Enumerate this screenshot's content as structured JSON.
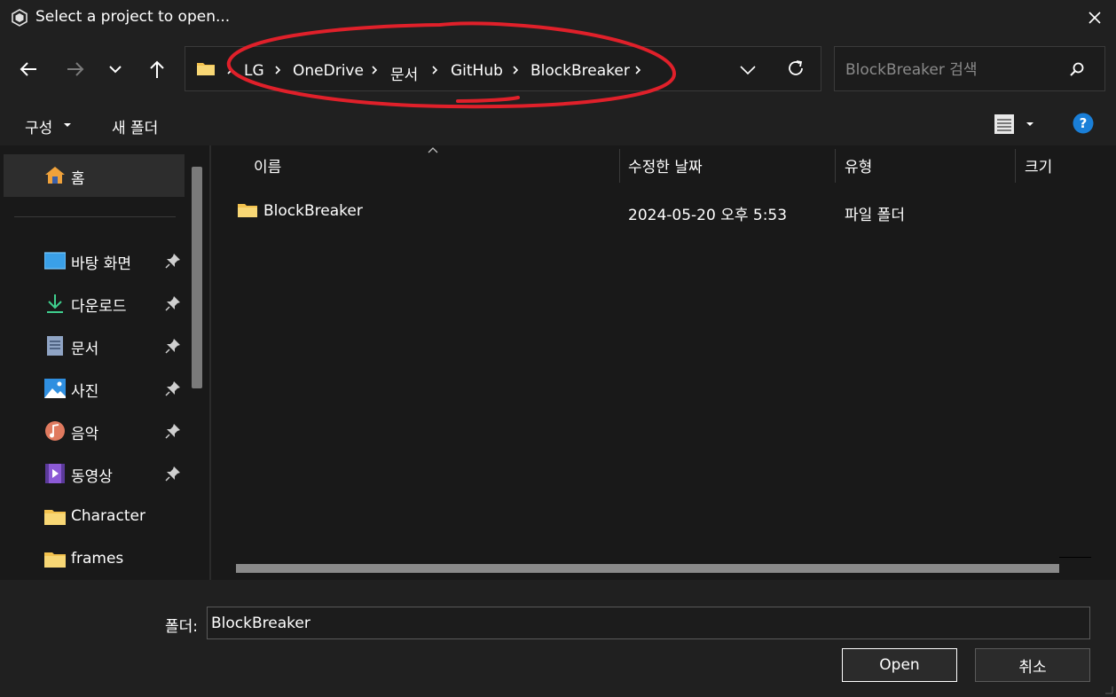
{
  "window": {
    "title": "Select a project to open..."
  },
  "address": {
    "crumbs": [
      "LG",
      "OneDrive",
      "문서",
      "GitHub",
      "BlockBreaker"
    ]
  },
  "search": {
    "placeholder": "BlockBreaker 검색"
  },
  "toolbar": {
    "organize_label": "구성",
    "new_folder_label": "새 폴더"
  },
  "sidebar": {
    "home_label": "홈",
    "items": [
      {
        "label": "바탕 화면",
        "icon": "desktop-icon",
        "pinned": true
      },
      {
        "label": "다운로드",
        "icon": "download-icon",
        "pinned": true
      },
      {
        "label": "문서",
        "icon": "documents-icon",
        "pinned": true
      },
      {
        "label": "사진",
        "icon": "pictures-icon",
        "pinned": true
      },
      {
        "label": "음악",
        "icon": "music-icon",
        "pinned": true
      },
      {
        "label": "동영상",
        "icon": "videos-icon",
        "pinned": true
      },
      {
        "label": "Character",
        "icon": "folder-icon",
        "pinned": false
      },
      {
        "label": "frames",
        "icon": "folder-icon",
        "pinned": false
      }
    ]
  },
  "columns": {
    "name": "이름",
    "modified": "수정한 날짜",
    "type": "유형",
    "size": "크기"
  },
  "files": [
    {
      "name": "BlockBreaker",
      "modified": "2024-05-20 오후 5:53",
      "type": "파일 폴더"
    }
  ],
  "footer": {
    "folder_label": "폴더:",
    "folder_value": "BlockBreaker",
    "open_label": "Open",
    "cancel_label": "취소"
  },
  "colors": {
    "accent": "#0078d4",
    "folder": "#f3c24e",
    "annotation": "#e0202a"
  }
}
